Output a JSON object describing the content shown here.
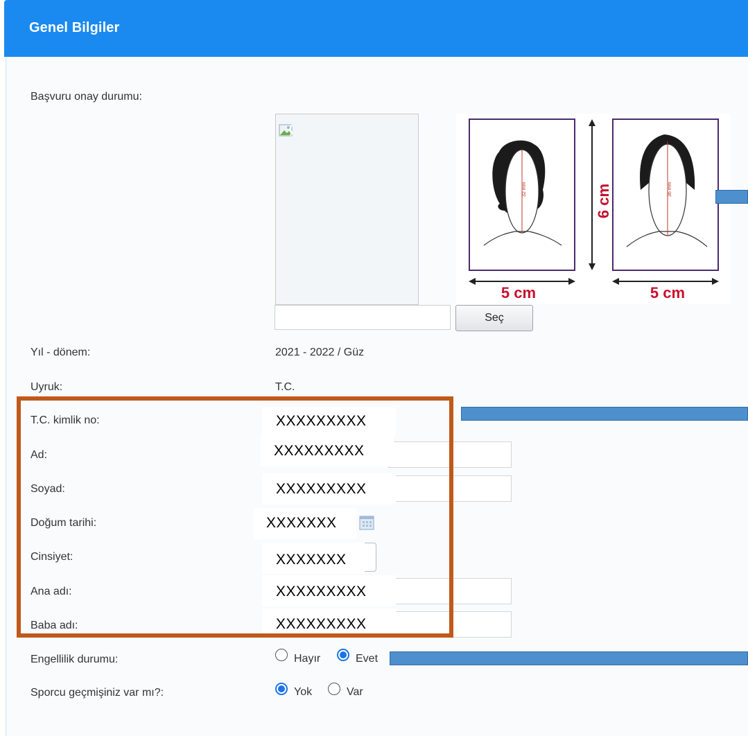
{
  "header": {
    "title": "Genel Bilgiler"
  },
  "photo": {
    "label": "Başvuru onay durumu:",
    "file_value": "",
    "select_button": "Seç",
    "sample_height": "6 cm",
    "sample_width_left": "5 cm",
    "sample_width_right": "5 cm",
    "sample_measure_left": "32 mm",
    "sample_measure_right": "36 mm"
  },
  "fields": {
    "year_label": "Yıl - dönem:",
    "year_value": "2021 - 2022 / Güz",
    "nationality_label": "Uyruk:",
    "nationality_value": "T.C.",
    "tc_label": "T.C. kimlik no:",
    "tc_value": "XXXXXXXXX",
    "name_label": "Ad:",
    "name_value": "XXXXXXXXX",
    "surname_label": "Soyad:",
    "surname_value": "XXXXXXXXX",
    "birth_label": "Doğum tarihi:",
    "birth_value": "XXXXXXX",
    "gender_label": "Cinsiyet:",
    "gender_value": "XXXXXXX",
    "mother_label": "Ana adı:",
    "mother_value": "XXXXXXXXX",
    "father_label": "Baba adı:",
    "father_value": "XXXXXXXXX"
  },
  "disability": {
    "label": "Engellilik durumu:",
    "option_no": "Hayır",
    "option_yes": "Evet",
    "selected": "Evet"
  },
  "athlete": {
    "label": "Sporcu geçmişiniz var mı?:",
    "option_no": "Yok",
    "option_yes": "Var",
    "selected": "Yok"
  },
  "colors": {
    "header": "#1a8af0",
    "highlight_frame": "#c0591a",
    "annotation_bar": "#4e8fce",
    "radio_checked": "#1a73e8"
  }
}
